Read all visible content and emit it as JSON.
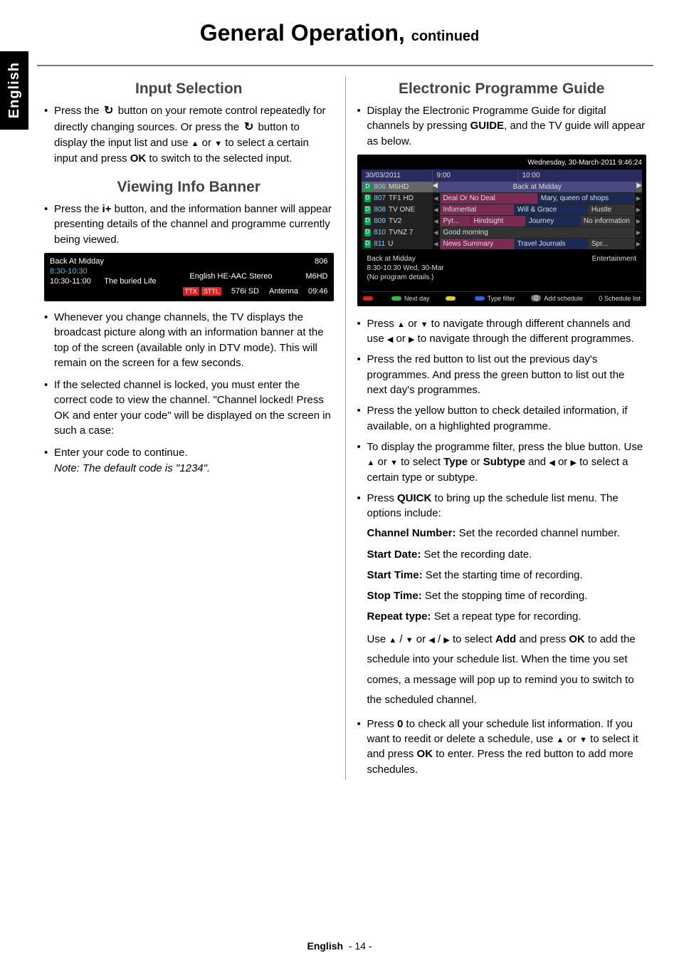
{
  "sidebar_label": "English",
  "page_title_main": "General Operation,",
  "page_title_cont": "continued",
  "footer_label": "English",
  "footer_page": "- 14 -",
  "left": {
    "input_selection": {
      "heading": "Input Selection",
      "b1_a": "Press the ",
      "b1_b": " button on your remote control repeatedly for directly changing sources. Or press the ",
      "b1_c": " button to display the input list and use ",
      "b1_d": " or ",
      "b1_e": " to select a certain input and press ",
      "b1_ok": "OK",
      "b1_f": " to switch to the selected input."
    },
    "viewing_info": {
      "heading": "Viewing Info Banner",
      "b1_a": "Press the ",
      "b1_iplus": "i+",
      "b1_b": " button, and the information banner will appear presenting details of the channel and programme currently being viewed.",
      "b2": "Whenever you change channels, the TV displays the broadcast picture along with an information banner at the top of the screen (available only in DTV mode). This will remain on the screen for a few seconds.",
      "b3": "If the selected channel is locked, you must enter the correct code to view the channel. \"Channel locked! Press OK and enter your code\" will be displayed on the screen in such a case:",
      "b4": "Enter your code to continue.",
      "b4_note": "Note: The default code is \"1234\"."
    },
    "banner": {
      "title": "Back At Midday",
      "t1": "8:30-10:30",
      "t2": "10:30-11:00",
      "prog2": "The buried Life",
      "ttx": "TTX",
      "sttl": "STTL",
      "audio": "English HE-AAC Stereo",
      "res": "576i SD",
      "chnum": "806",
      "chname": "M6HD",
      "src": "Antenna",
      "clock": "09:46"
    }
  },
  "right": {
    "heading": "Electronic Programme Guide",
    "b1_a": "Display the Electronic Programme Guide for digital channels by pressing ",
    "b1_guide": "GUIDE",
    "b1_b": ", and the TV guide will appear as below.",
    "b2_a": "Press ",
    "b2_b": " or ",
    "b2_c": " to navigate through different channels and use ",
    "b2_d": " or ",
    "b2_e": " to navigate through the different programmes.",
    "b3": "Press the red button to list out the previous day's programmes. And press the green button to list out the next day's programmes.",
    "b4": "Press the yellow button to check detailed information, if available, on a highlighted programme.",
    "b5_a": "To display the programme filter, press the blue button. Use ",
    "b5_b": " or ",
    "b5_c": " to select ",
    "b5_type": "Type",
    "b5_d": " or ",
    "b5_sub": "Subtype",
    "b5_e": " and ",
    "b5_f": " or ",
    "b5_g": " to select a certain type or subtype.",
    "b6_a": "Press ",
    "b6_quick": "QUICK",
    "b6_b": " to bring up the schedule list menu. The options include:",
    "opt_chnum_l": "Channel Number:",
    "opt_chnum_t": " Set the recorded channel number.",
    "opt_sdate_l": "Start Date:",
    "opt_sdate_t": " Set the recording date.",
    "opt_stime_l": "Start Time:",
    "opt_stime_t": " Set the starting time of recording.",
    "opt_etime_l": "Stop Time:",
    "opt_etime_t": " Set the stopping time of recording.",
    "opt_rep_l": "Repeat type:",
    "opt_rep_t": " Set a repeat type for recording.",
    "use_a": "Use ",
    "use_b": " / ",
    "use_c": " or ",
    "use_d": " / ",
    "use_e": " to select ",
    "use_add1": "Add",
    "use_f": " and press ",
    "use_ok": "OK",
    "use_g": " to add the schedule into your schedule list. When the time you set comes, a message will pop up to remind you to switch to the scheduled channel.",
    "b7_a": "Press ",
    "b7_zero": "0",
    "b7_b": " to check all your schedule list information. If you want to reedit or delete a schedule, use ",
    "b7_c": " or ",
    "b7_d": " to select it and press ",
    "b7_ok": "OK",
    "b7_e": " to enter. Press the red button to add more schedules."
  },
  "epg": {
    "topbar": "Wednesday, 30-March-2011  9:46:24",
    "date": "30/03/2011",
    "t900": "9:00",
    "t1000": "10:00",
    "sel_num": "806",
    "sel_name": "M6HD",
    "sel_prog": "Back at Midday",
    "rows": [
      {
        "num": "807",
        "name": "TF1 HD",
        "c1": "Deal Or No Deal",
        "c2": "Mary, queen of shops",
        "c3": ""
      },
      {
        "num": "808",
        "name": "TV ONE",
        "c1": "Infomertial",
        "c2": "Will & Grace",
        "c3": "Hustle"
      },
      {
        "num": "809",
        "name": "TV2",
        "c1": "Pyt...",
        "c1b": "Hindsight",
        "c2": "Journey",
        "c3": "No information"
      },
      {
        "num": "810",
        "name": "TVNZ 7",
        "full": "Good morning"
      },
      {
        "num": "811",
        "name": "U",
        "c1": "News Summary",
        "c2": "Travel Journals",
        "c3": "Spr..."
      }
    ],
    "det_title": "Back at Midday",
    "det_time": "8:30-10:30 Wed, 30-Mar",
    "det_none": "(No program details.)",
    "det_cat": "Entertainment",
    "foot_prev": "",
    "foot_next": "Next day",
    "foot_yellow": "",
    "foot_type": "Type filter",
    "foot_add": "Add schedule",
    "foot_sched": "0  Schedule list"
  }
}
